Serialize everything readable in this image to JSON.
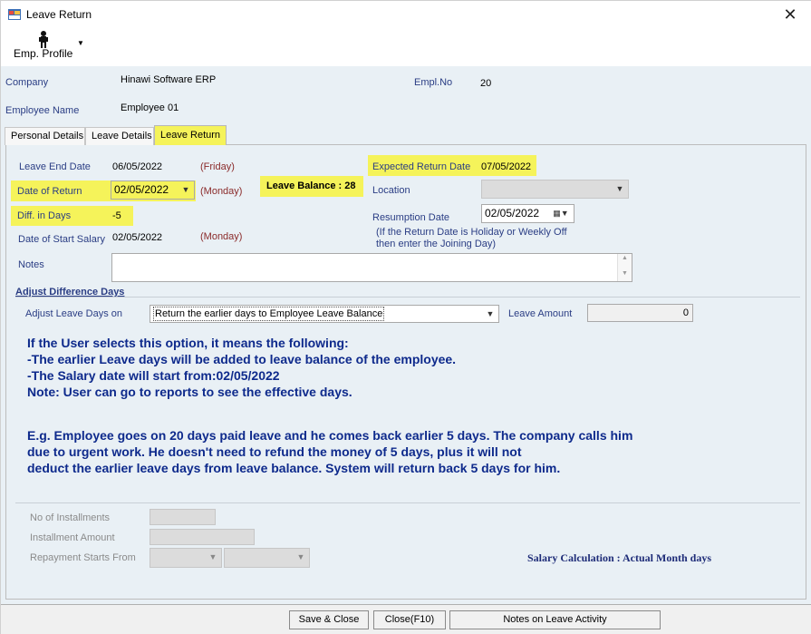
{
  "window": {
    "title": "Leave Return",
    "close_glyph": "✕"
  },
  "toolbar": {
    "emp_profile_label": "Emp. Profile"
  },
  "header": {
    "company_label": "Company",
    "company_value": "Hinawi Software ERP",
    "empl_no_label": "Empl.No",
    "empl_no_value": "20",
    "employee_name_label": "Employee Name",
    "employee_name_value": "Employee 01"
  },
  "tabs": [
    {
      "label": "Personal Details"
    },
    {
      "label": "Leave Details"
    },
    {
      "label": "Leave Return"
    }
  ],
  "leave_return": {
    "leave_end_date_label": "Leave End Date",
    "leave_end_date_value": "06/05/2022",
    "leave_end_day": "(Friday)",
    "date_of_return_label": "Date of Return",
    "date_of_return_value": "02/05/2022",
    "date_of_return_day": "(Monday)",
    "leave_balance": "Leave Balance : 28",
    "diff_in_days_label": "Diff. in Days",
    "diff_in_days_value": "-5",
    "date_of_start_salary_label": "Date of Start Salary",
    "date_of_start_salary_value": "02/05/2022",
    "date_of_start_salary_day": "(Monday)",
    "notes_label": "Notes",
    "expected_return_label": "Expected Return Date",
    "expected_return_value": "07/05/2022",
    "location_label": "Location",
    "location_value": "",
    "resumption_date_label": "Resumption Date",
    "resumption_date_value": "02/05/2022",
    "resumption_hint_line1": "(If the Return Date is Holiday or Weekly Off",
    "resumption_hint_line2": "then enter the Joining Day)"
  },
  "adjust": {
    "section_title": "Adjust Difference Days",
    "adjust_on_label": "Adjust Leave Days on",
    "adjust_on_value": "Return the earlier days to Employee Leave Balance",
    "leave_amount_label": "Leave Amount",
    "leave_amount_value": "0"
  },
  "info": {
    "line1": "If the User selects this option, it means the following:",
    "line2": "-The earlier Leave days will be added to leave balance of the employee.",
    "line3": "-The Salary date will start from:02/05/2022",
    "line4": "Note: User can go to reports to see the effective days.",
    "line5": "E.g. Employee goes on 20 days paid leave and he comes back earlier 5 days. The company calls him",
    "line6": "due to urgent work. He doesn't need to refund the money of 5 days, plus it will not",
    "line7": "deduct the earlier leave days from leave balance. System will return back 5 days for him."
  },
  "installments": {
    "no_of_installments_label": "No of Installments",
    "installment_amount_label": "Installment Amount",
    "repayment_starts_label": "Repayment Starts From",
    "salary_calculation": "Salary Calculation : Actual Month days"
  },
  "buttons": {
    "save_close": "Save & Close",
    "close": "Close(F10)",
    "notes_on_leave": "Notes on Leave Activity"
  },
  "colors": {
    "highlight": "#f5f35a",
    "label_blue": "#2a3d84",
    "day_maroon": "#8a2a2a",
    "info_blue": "#0e2a8c"
  }
}
